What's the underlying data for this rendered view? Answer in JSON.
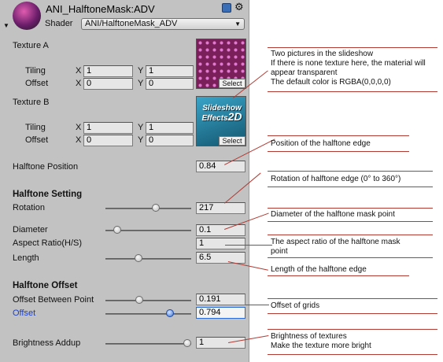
{
  "header": {
    "title": "ANI_HalftoneMask:ADV",
    "shader_label": "Shader",
    "shader_value": "ANI/HalftoneMask_ADV",
    "book_icon": "book-icon",
    "gear_icon": "gear-icon",
    "fold_icon": "triangle-down-icon"
  },
  "texture_a": {
    "label": "Texture A",
    "tiling_label": "Tiling",
    "offset_label": "Offset",
    "x_label": "X",
    "y_label": "Y",
    "tiling_x": "1",
    "tiling_y": "1",
    "offset_x": "0",
    "offset_y": "0",
    "select": "Select"
  },
  "texture_b": {
    "label": "Texture B",
    "tiling_label": "Tiling",
    "offset_label": "Offset",
    "x_label": "X",
    "y_label": "Y",
    "tiling_x": "1",
    "tiling_y": "1",
    "offset_x": "0",
    "offset_y": "0",
    "select": "Select",
    "thumb_text_1": "Slideshow",
    "thumb_text_2": "Effects",
    "thumb_text_3": "2D"
  },
  "halftone_position": {
    "label": "Halftone Position",
    "value": "0.84"
  },
  "halftone_setting": {
    "heading": "Halftone Setting",
    "rotation": {
      "label": "Rotation",
      "value": "217",
      "fraction": 0.6
    },
    "diameter": {
      "label": "Diameter",
      "value": "0.1",
      "fraction": 0.1
    },
    "aspect": {
      "label": "Aspect Ratio(H/S)",
      "value": "1"
    },
    "length": {
      "label": "Length",
      "value": "6.5",
      "fraction": 0.37
    }
  },
  "halftone_offset": {
    "heading": "Halftone Offset",
    "between": {
      "label": "Offset Between Point",
      "value": "0.191",
      "fraction": 0.38
    },
    "offset": {
      "label": "Offset",
      "value": "0.794",
      "fraction": 0.78
    }
  },
  "brightness": {
    "label": "Brightness Addup",
    "value": "1",
    "fraction": 1.0
  },
  "callouts": {
    "textures": [
      "Two pictures in the slideshow",
      "If there is none texture here, the material will",
      "appear transparent",
      "The default color is RGBA(0,0,0,0)"
    ],
    "position": "Position of the halftone edge",
    "rotation": "Rotation of halftone edge (0° to 360°)",
    "diameter": "Diameter of the halftone mask point",
    "aspect": [
      "The aspect ratio of the halftone mask",
      "point"
    ],
    "length": "Length of the halftone edge",
    "offset": "Offset of grids",
    "brightness": [
      "Brightness of textures",
      "Make the texture more bright"
    ]
  },
  "colors": {
    "panel": "#c2c2c2",
    "callout_line": "#b23b34",
    "active_blue": "#1a3fc8"
  }
}
